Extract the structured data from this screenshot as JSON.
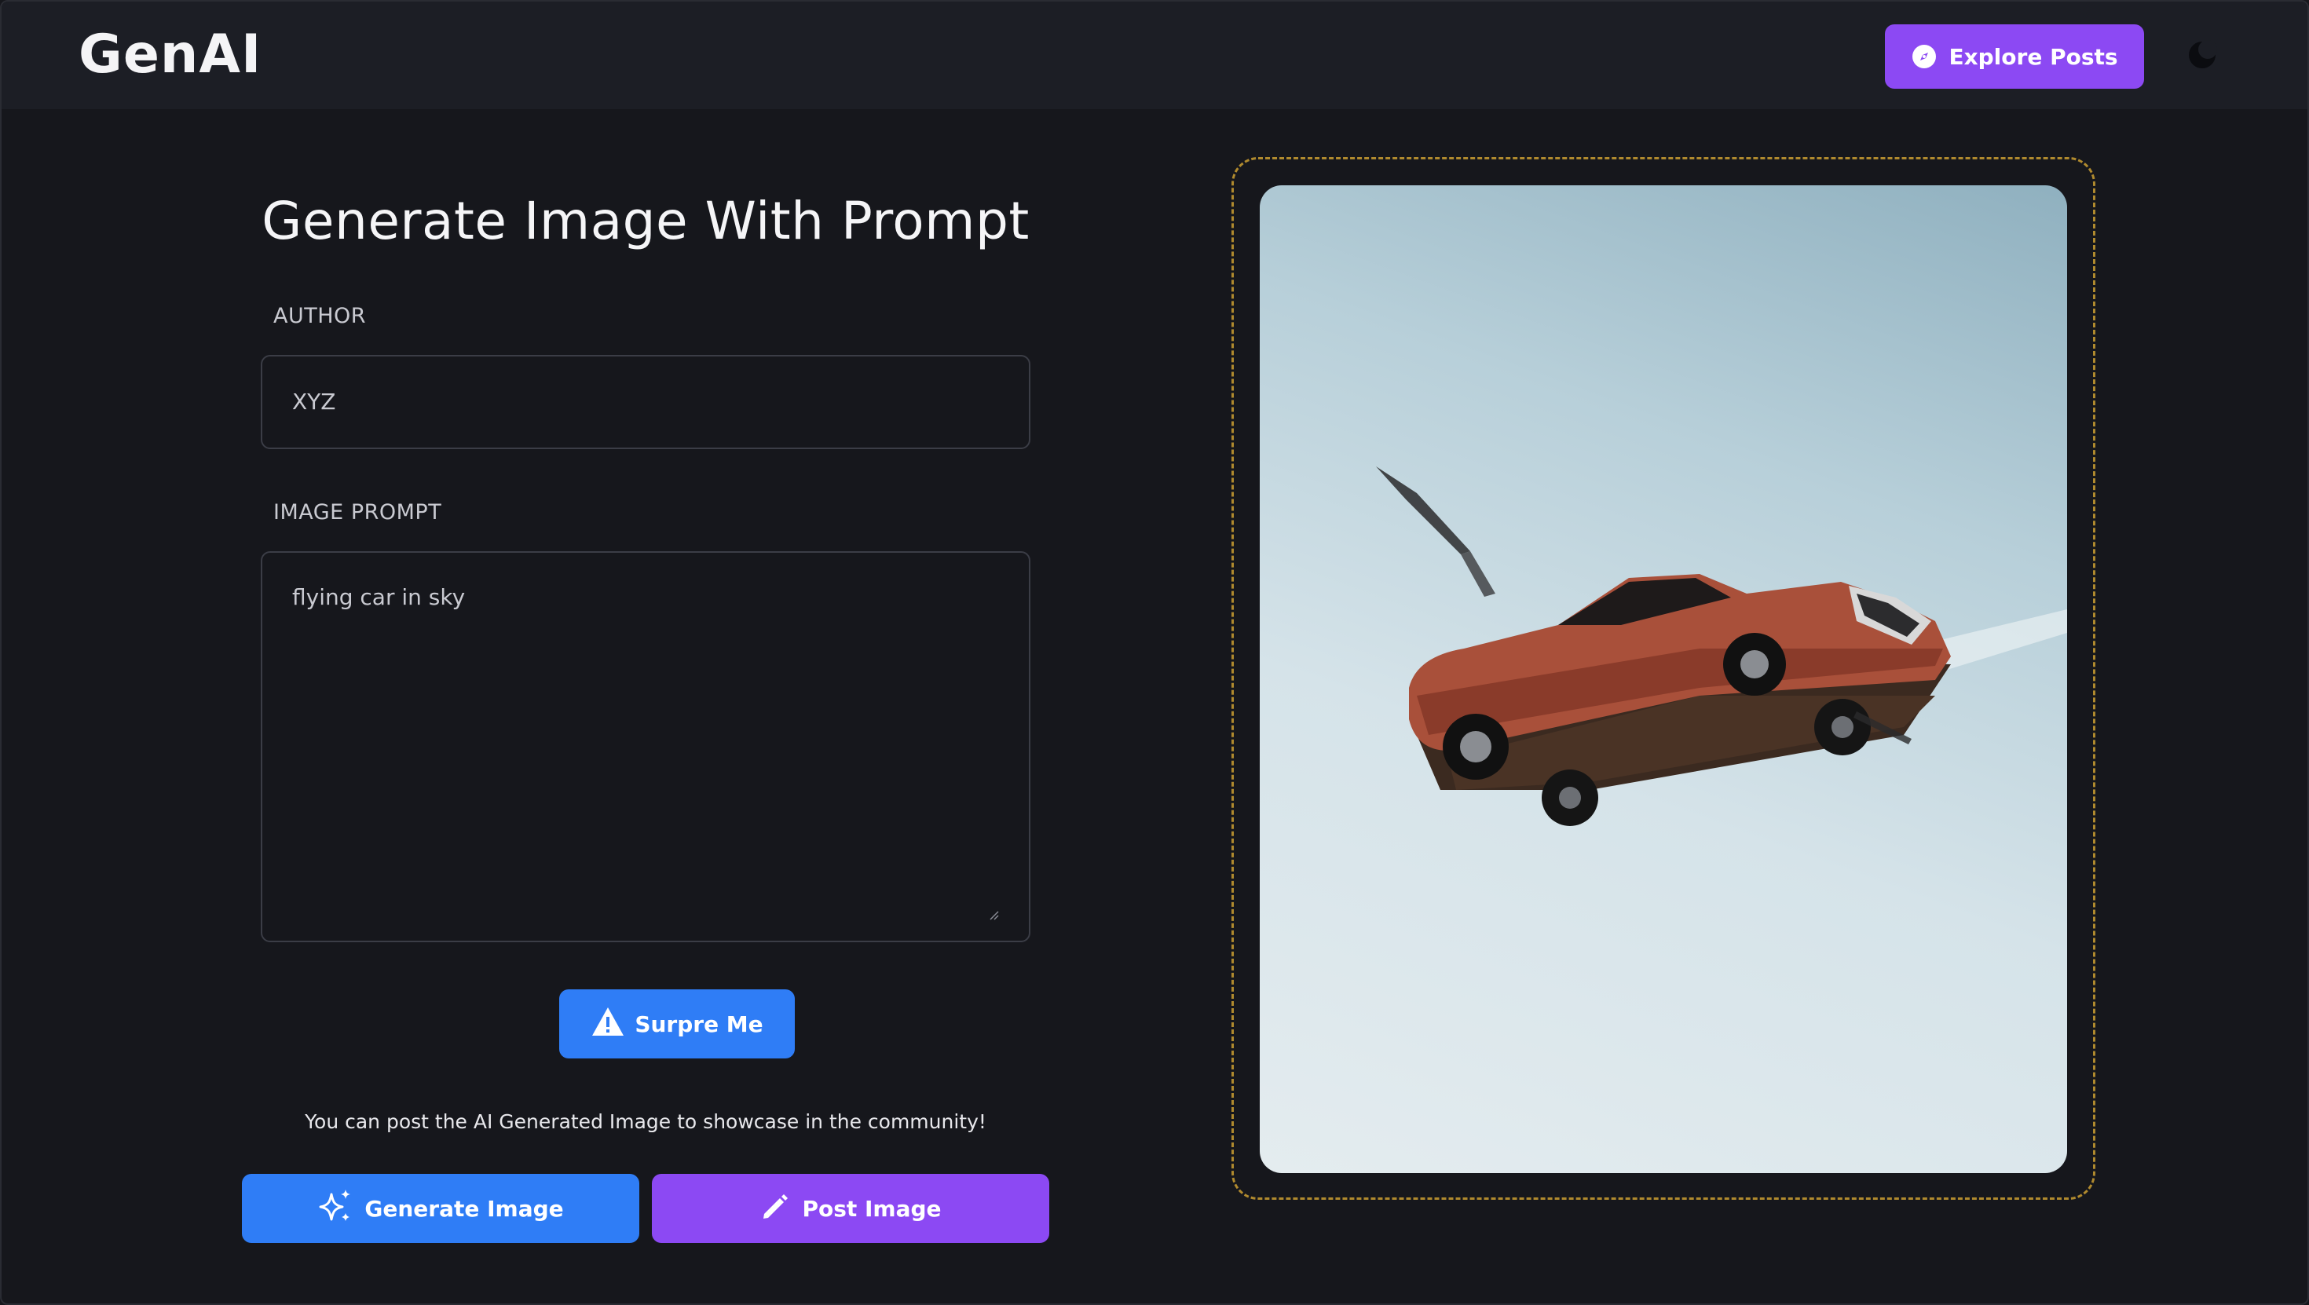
{
  "header": {
    "logo": "GenAI",
    "explore_label": "Explore Posts"
  },
  "form": {
    "title": "Generate Image With Prompt",
    "author_label": "AUTHOR",
    "author_value": "XYZ",
    "prompt_label": "IMAGE PROMPT",
    "prompt_value": "flying car in sky",
    "surprise_label": "Surpre Me",
    "hint": "You can post the AI Generated Image to showcase in the community!",
    "generate_label": "Generate Image",
    "post_label": "Post Image"
  },
  "colors": {
    "background": "#16171c",
    "header_bg": "#1c1e25",
    "primary_blue": "#2f7df6",
    "primary_purple": "#8c49f3",
    "dashed_border": "#b08a2e"
  },
  "icons": {
    "explore": "compass-icon",
    "theme": "moon-icon",
    "surprise": "warning-icon",
    "generate": "sparkles-icon",
    "post": "pencil-icon"
  }
}
